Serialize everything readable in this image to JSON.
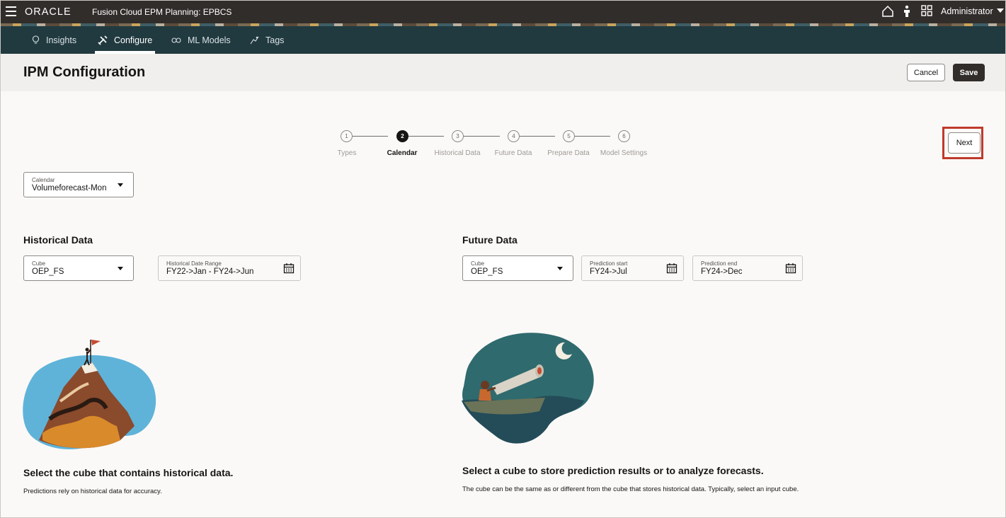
{
  "topbar": {
    "logo": "ORACLE",
    "app_title": "Fusion Cloud EPM Planning:  EPBCS",
    "user": "Administrator",
    "icons": [
      "hamburger-menu-icon",
      "home-icon",
      "accessibility-icon",
      "grid-apps-icon"
    ]
  },
  "nav": {
    "tabs": [
      {
        "label": "Insights",
        "icon": "lightbulb-icon",
        "active": false
      },
      {
        "label": "Configure",
        "icon": "tools-icon",
        "active": true
      },
      {
        "label": "ML Models",
        "icon": "model-icon",
        "active": false
      },
      {
        "label": "Tags",
        "icon": "tag-icon",
        "active": false
      }
    ]
  },
  "header": {
    "title": "IPM Configuration",
    "cancel_label": "Cancel",
    "save_label": "Save"
  },
  "stepper": {
    "current": 2,
    "steps": [
      {
        "number": "1",
        "label": "Types"
      },
      {
        "number": "2",
        "label": "Calendar"
      },
      {
        "number": "3",
        "label": "Historical Data"
      },
      {
        "number": "4",
        "label": "Future Data"
      },
      {
        "number": "5",
        "label": "Prepare Data"
      },
      {
        "number": "6",
        "label": "Model Settings"
      }
    ],
    "next_label": "Next"
  },
  "calendar": {
    "label": "Calendar",
    "value": "Volumeforecast-Mon"
  },
  "historical": {
    "title": "Historical Data",
    "cube_label": "Cube",
    "cube_value": "OEP_FS",
    "range_label": "Historical Date Range",
    "range_value": "FY22->Jan - FY24->Jun",
    "desc_title": "Select the cube that contains historical data.",
    "desc_text": "Predictions rely on historical data for accuracy."
  },
  "future": {
    "title": "Future Data",
    "cube_label": "Cube",
    "cube_value": "OEP_FS",
    "start_label": "Prediction start",
    "start_value": "FY24->Jul",
    "end_label": "Prediction end",
    "end_value": "FY24->Dec",
    "desc_title": "Select a cube to store prediction results or to analyze forecasts.",
    "desc_text": "The cube can be the same as or different from the cube that stores historical data. Typically, select an input cube."
  },
  "colors": {
    "topbar": "#312d2a",
    "navbar": "#213a40",
    "highlight": "#c0392b"
  }
}
